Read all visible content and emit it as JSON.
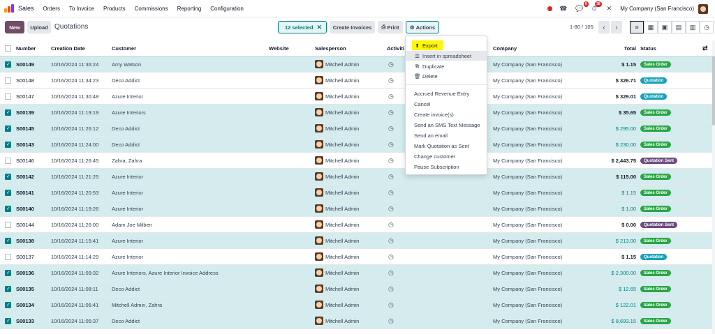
{
  "nav": {
    "app": "Sales",
    "menu": [
      "Orders",
      "To Invoice",
      "Products",
      "Commissions",
      "Reporting",
      "Configuration"
    ],
    "badge_messages": "6",
    "badge_activities": "38",
    "company": "My Company (San Francisco)"
  },
  "toolbar": {
    "new_label": "New",
    "upload_label": "Upload",
    "title": "Quotations",
    "selected_label": "12 selected",
    "create_invoices_label": "Create Invoices",
    "print_label": "Print",
    "actions_label": "Actions",
    "pager": "1-80 / 105"
  },
  "table": {
    "headers": {
      "number": "Number",
      "creation_date": "Creation Date",
      "customer": "Customer",
      "website": "Website",
      "salesperson": "Salesperson",
      "activities": "Activiti",
      "company": "Company",
      "total": "Total",
      "status": "Status"
    },
    "rows": [
      {
        "selected": true,
        "number": "S00149",
        "date": "10/16/2024 11:36:24",
        "customer": "Amy Watson",
        "salesperson": "Mitchell Admin",
        "company": "My Company (San Francisco)",
        "total": "$ 1.15",
        "total_style": "bold",
        "status": "Sales Order",
        "status_kind": "so"
      },
      {
        "selected": false,
        "number": "S00148",
        "date": "10/16/2024 11:34:23",
        "customer": "Deco Addict",
        "salesperson": "Mitchell Admin",
        "company": "My Company (San Francisco)",
        "total": "$ 326.71",
        "total_style": "bold",
        "status": "Quotation",
        "status_kind": "q"
      },
      {
        "selected": false,
        "number": "S00147",
        "date": "10/16/2024 11:30:48",
        "customer": "Azure Interior",
        "salesperson": "Mitchell Admin",
        "company": "My Company (San Francisco)",
        "total": "$ 329.01",
        "total_style": "bold",
        "status": "Quotation",
        "status_kind": "q"
      },
      {
        "selected": true,
        "number": "S00139",
        "date": "10/16/2024 11:19:19",
        "customer": "Azure Interiors",
        "salesperson": "Mitchell Admin",
        "company": "My Company (San Francisco)",
        "total": "$ 35.65",
        "total_style": "bold",
        "status": "Sales Order",
        "status_kind": "so"
      },
      {
        "selected": true,
        "number": "S00145",
        "date": "10/16/2024 11:26:12",
        "customer": "Deco Addict",
        "salesperson": "Mitchell Admin",
        "company": "My Company (San Francisco)",
        "total": "$ 295.00",
        "total_style": "teal",
        "status": "Sales Order",
        "status_kind": "so"
      },
      {
        "selected": true,
        "number": "S00143",
        "date": "10/16/2024 11:24:00",
        "customer": "Deco Addict",
        "salesperson": "Mitchell Admin",
        "company": "My Company (San Francisco)",
        "total": "$ 230.00",
        "total_style": "teal",
        "status": "Sales Order",
        "status_kind": "so"
      },
      {
        "selected": false,
        "number": "S00146",
        "date": "10/16/2024 11:26:45",
        "customer": "Zahra, Zahra",
        "salesperson": "Mitchell Admin",
        "company": "My Company (San Francisco)",
        "total": "$ 2,443.75",
        "total_style": "bold",
        "status": "Quotation Sent",
        "status_kind": "qs"
      },
      {
        "selected": true,
        "number": "S00142",
        "date": "10/16/2024 11:21:25",
        "customer": "Azure Interior",
        "salesperson": "Mitchell Admin",
        "company": "My Company (San Francisco)",
        "total": "$ 115.00",
        "total_style": "bold",
        "status": "Sales Order",
        "status_kind": "so"
      },
      {
        "selected": true,
        "number": "S00141",
        "date": "10/16/2024 11:20:53",
        "customer": "Azure Interior",
        "salesperson": "Mitchell Admin",
        "company": "My Company (San Francisco)",
        "total": "$ 1.15",
        "total_style": "teal",
        "status": "Sales Order",
        "status_kind": "so"
      },
      {
        "selected": true,
        "number": "S00140",
        "date": "10/16/2024 11:19:26",
        "customer": "Azure Interior",
        "salesperson": "Mitchell Admin",
        "company": "My Company (San Francisco)",
        "total": "$ 1.00",
        "total_style": "teal",
        "status": "Sales Order",
        "status_kind": "so"
      },
      {
        "selected": false,
        "number": "S00144",
        "date": "10/16/2024 11:26:00",
        "customer": "Adam Joe Milben",
        "salesperson": "Mitchell Admin",
        "company": "My Company (San Francisco)",
        "total": "$ 0.00",
        "total_style": "bold",
        "status": "Quotation Sent",
        "status_kind": "qs"
      },
      {
        "selected": true,
        "number": "S00138",
        "date": "10/16/2024 11:15:41",
        "customer": "Azure Interior",
        "salesperson": "Mitchell Admin",
        "company": "My Company (San Francisco)",
        "total": "$ 213.00",
        "total_style": "teal",
        "status": "Sales Order",
        "status_kind": "so"
      },
      {
        "selected": false,
        "number": "S00137",
        "date": "10/16/2024 11:14:29",
        "customer": "Azure Interior",
        "salesperson": "Mitchell Admin",
        "company": "My Company (San Francisco)",
        "total": "$ 1.15",
        "total_style": "bold",
        "status": "Quotation",
        "status_kind": "q"
      },
      {
        "selected": true,
        "number": "S00136",
        "date": "10/16/2024 11:09:32",
        "customer": "Azure Interiors, Azure Interior Invoice Address",
        "salesperson": "Mitchell Admin",
        "company": "My Company (San Francisco)",
        "total": "$ 2,300.00",
        "total_style": "teal",
        "status": "Sales Order",
        "status_kind": "so"
      },
      {
        "selected": true,
        "number": "S00135",
        "date": "10/16/2024 11:08:11",
        "customer": "Deco Addict",
        "salesperson": "Mitchell Admin",
        "company": "My Company (San Francisco)",
        "total": "$ 12.65",
        "total_style": "teal",
        "status": "Sales Order",
        "status_kind": "so"
      },
      {
        "selected": true,
        "number": "S00134",
        "date": "10/16/2024 11:06:41",
        "customer": "Mitchell Admin, Zahra",
        "salesperson": "Mitchell Admin",
        "company": "My Company (San Francisco)",
        "total": "$ 122.01",
        "total_style": "teal",
        "status": "Sales Order",
        "status_kind": "so"
      },
      {
        "selected": true,
        "number": "S00133",
        "date": "10/16/2024 11:05:37",
        "customer": "Deco Addict",
        "salesperson": "Mitchell Admin",
        "company": "My Company (San Francisco)",
        "total": "$ 8,693.15",
        "total_style": "teal",
        "status": "Sales Order",
        "status_kind": "so"
      }
    ]
  },
  "actions_menu": {
    "export": "Export",
    "insert_spreadsheet": "Insert in spreadsheet",
    "duplicate": "Duplicate",
    "delete": "Delete",
    "items": [
      "Accrued Revenue Entry",
      "Cancel",
      "Create invoice(s)",
      "Send an SMS Text Message",
      "Send an email",
      "Mark Quotation as Sent",
      "Change customer",
      "Pause Subscription"
    ]
  },
  "colors": {
    "brand": "#714b67",
    "accent": "#017e84",
    "highlight": "#fff600",
    "sales_order": "#28a745",
    "quotation": "#17a2b8",
    "quotation_sent": "#6d4c7d"
  }
}
